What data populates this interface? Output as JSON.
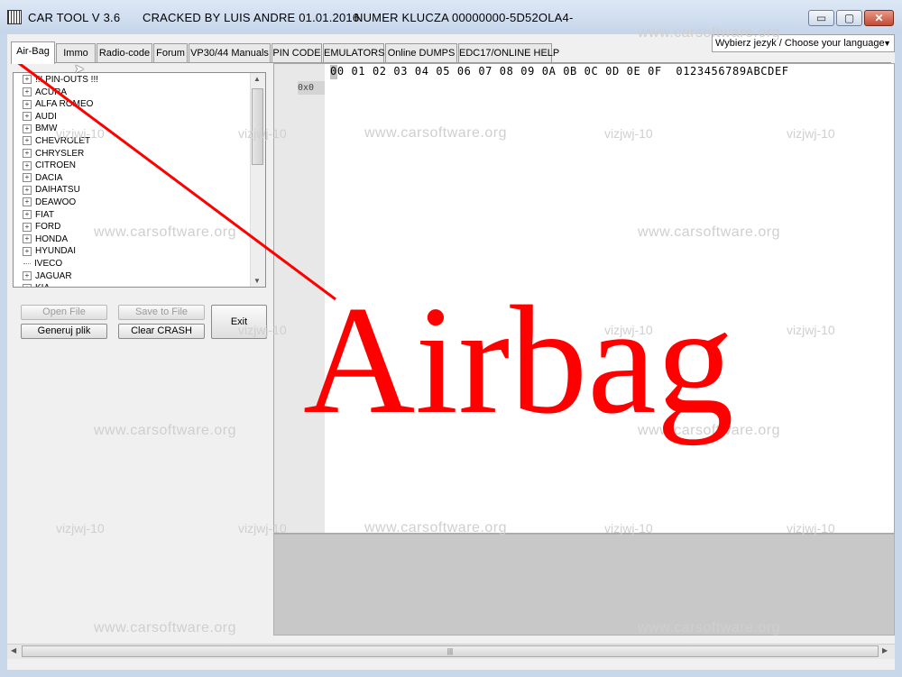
{
  "window": {
    "title_app": "CAR TOOL V 3.6",
    "title_cracked": "CRACKED BY LUIS ANDRE 01.01.2016",
    "title_key": "NUMER KLUCZA 00000000-5D52OLA4-",
    "minimize_glyph": "▭",
    "maximize_glyph": "▢",
    "close_glyph": "✕"
  },
  "tabs": [
    {
      "label": "Air-Bag",
      "active": true
    },
    {
      "label": "Immo"
    },
    {
      "label": "Radio-code"
    },
    {
      "label": "Forum"
    },
    {
      "label": "VP30/44 Manuals"
    },
    {
      "label": "PIN CODE"
    },
    {
      "label": "EMULATORS"
    },
    {
      "label": "Online DUMPS"
    },
    {
      "label": "EDC17/ONLINE HELP"
    }
  ],
  "language": {
    "selected": "Wybierz jezyk / Choose your language"
  },
  "tree": {
    "items": [
      {
        "label": "!!! PIN-OUTS !!!",
        "expandable": true
      },
      {
        "label": "ACURA",
        "expandable": true
      },
      {
        "label": "ALFA ROMEO",
        "expandable": true
      },
      {
        "label": "AUDI",
        "expandable": true
      },
      {
        "label": "BMW",
        "expandable": true
      },
      {
        "label": "CHEVROLET",
        "expandable": true
      },
      {
        "label": "CHRYSLER",
        "expandable": true
      },
      {
        "label": "CITROEN",
        "expandable": true
      },
      {
        "label": "DACIA",
        "expandable": true
      },
      {
        "label": "DAIHATSU",
        "expandable": true
      },
      {
        "label": "DEAWOO",
        "expandable": true
      },
      {
        "label": "FIAT",
        "expandable": true
      },
      {
        "label": "FORD",
        "expandable": true
      },
      {
        "label": "HONDA",
        "expandable": true
      },
      {
        "label": "HYUNDAI",
        "expandable": true
      },
      {
        "label": "IVECO",
        "expandable": false
      },
      {
        "label": "JAGUAR",
        "expandable": true
      },
      {
        "label": "KIA",
        "expandable": true
      }
    ]
  },
  "buttons": {
    "open_file": "Open File",
    "save_to_file": "Save to File",
    "generate": "Generuj plik",
    "clear_crash": "Clear CRASH",
    "exit": "Exit"
  },
  "hex": {
    "header": "00 01 02 03 04 05 06 07 08 09 0A 0B 0C 0D 0E 0F  0123456789ABCDEF",
    "offset": "0x0"
  },
  "annotation": {
    "text": "Airbag",
    "color": "#ff0000"
  },
  "watermarks": {
    "site": "www.carsoftware.org",
    "tag": "vizjwj-10"
  },
  "colors": {
    "accent_red": "#ff0000",
    "titlebar": "#c9d7ea"
  }
}
